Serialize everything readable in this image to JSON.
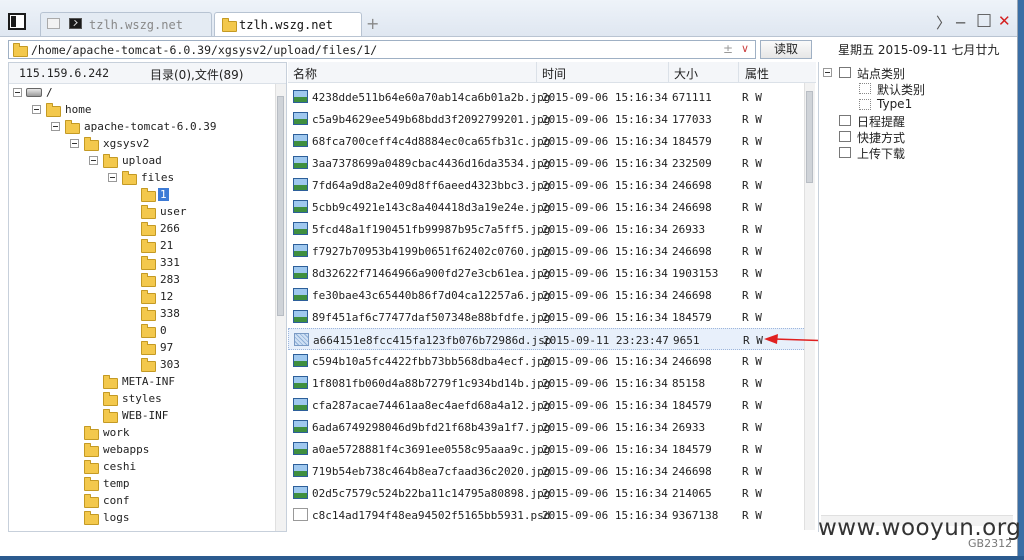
{
  "tabs": [
    {
      "label": "tzlh.wszg.net",
      "active": false,
      "icon": "terminal-icon"
    },
    {
      "label": "tzlh.wszg.net",
      "active": true,
      "icon": "folder-icon"
    }
  ],
  "window_controls": {
    "forward": "〉",
    "minimize": "─",
    "maximize": "□",
    "close": "✕"
  },
  "address": {
    "path": "/home/apache-tomcat-6.0.39/xgsysv2/upload/files/1/",
    "add_remove": "± ",
    "dropdown": "∨"
  },
  "read_button": "读取",
  "date_text": "星期五 2015-09-11 七月廿九",
  "left_pane": {
    "ip": "115.159.6.242",
    "summary": "目录(0),文件(89)",
    "tree": [
      {
        "label": "/",
        "depth": 0,
        "drive": true,
        "selected": false
      },
      {
        "label": "home",
        "depth": 1,
        "selected": false
      },
      {
        "label": "apache-tomcat-6.0.39",
        "depth": 2,
        "selected": false
      },
      {
        "label": "xgsysv2",
        "depth": 3,
        "selected": false
      },
      {
        "label": "upload",
        "depth": 4,
        "selected": false
      },
      {
        "label": "files",
        "depth": 5,
        "selected": false
      },
      {
        "label": "1",
        "depth": 6,
        "selected": true
      },
      {
        "label": "user",
        "depth": 6,
        "selected": false
      },
      {
        "label": "266",
        "depth": 6,
        "selected": false
      },
      {
        "label": "21",
        "depth": 6,
        "selected": false
      },
      {
        "label": "331",
        "depth": 6,
        "selected": false
      },
      {
        "label": "283",
        "depth": 6,
        "selected": false
      },
      {
        "label": "12",
        "depth": 6,
        "selected": false
      },
      {
        "label": "338",
        "depth": 6,
        "selected": false
      },
      {
        "label": "0",
        "depth": 6,
        "selected": false
      },
      {
        "label": "97",
        "depth": 6,
        "selected": false
      },
      {
        "label": "303",
        "depth": 6,
        "selected": false
      },
      {
        "label": "META-INF",
        "depth": 4,
        "selected": false
      },
      {
        "label": "styles",
        "depth": 4,
        "selected": false
      },
      {
        "label": "WEB-INF",
        "depth": 4,
        "selected": false
      },
      {
        "label": "work",
        "depth": 3,
        "selected": false
      },
      {
        "label": "webapps",
        "depth": 3,
        "selected": false
      },
      {
        "label": "ceshi",
        "depth": 3,
        "selected": false
      },
      {
        "label": "temp",
        "depth": 3,
        "selected": false
      },
      {
        "label": "conf",
        "depth": 3,
        "selected": false
      },
      {
        "label": "logs",
        "depth": 3,
        "selected": false
      }
    ]
  },
  "file_list": {
    "columns": {
      "name": "名称",
      "time": "时间",
      "size": "大小",
      "attr": "属性"
    },
    "rows": [
      {
        "name": "4238dde511b64e60a70ab14ca6b01a2b.jpg",
        "time": "2015-09-06 15:16:34",
        "size": "671111",
        "attr": "R W",
        "type": "img"
      },
      {
        "name": "c5a9b4629ee549b68bdd3f2092799201.jpg",
        "time": "2015-09-06 15:16:34",
        "size": "177033",
        "attr": "R W",
        "type": "img"
      },
      {
        "name": "68fca700ceff4c4d8884ec0ca65fb31c.jpg",
        "time": "2015-09-06 15:16:34",
        "size": "184579",
        "attr": "R W",
        "type": "img"
      },
      {
        "name": "3aa7378699a0489cbac4436d16da3534.jpg",
        "time": "2015-09-06 15:16:34",
        "size": "232509",
        "attr": "R W",
        "type": "img"
      },
      {
        "name": "7fd64a9d8a2e409d8ff6aeed4323bbc3.jpg",
        "time": "2015-09-06 15:16:34",
        "size": "246698",
        "attr": "R W",
        "type": "img"
      },
      {
        "name": "5cbb9c4921e143c8a404418d3a19e24e.jpg",
        "time": "2015-09-06 15:16:34",
        "size": "246698",
        "attr": "R W",
        "type": "img"
      },
      {
        "name": "5fcd48a1f190451fb99987b95c7a5ff5.jpg",
        "time": "2015-09-06 15:16:34",
        "size": "26933",
        "attr": "R W",
        "type": "img"
      },
      {
        "name": "f7927b70953b4199b0651f62402c0760.jpg",
        "time": "2015-09-06 15:16:34",
        "size": "246698",
        "attr": "R W",
        "type": "img"
      },
      {
        "name": "8d32622f71464966a900fd27e3cb61ea.jpg",
        "time": "2015-09-06 15:16:34",
        "size": "1903153",
        "attr": "R W",
        "type": "img"
      },
      {
        "name": "fe30bae43c65440b86f7d04ca12257a6.jpg",
        "time": "2015-09-06 15:16:34",
        "size": "246698",
        "attr": "R W",
        "type": "img"
      },
      {
        "name": "89f451af6c77477daf507348e88bfdfe.jpg",
        "time": "2015-09-06 15:16:34",
        "size": "184579",
        "attr": "R W",
        "type": "img"
      },
      {
        "name": "a664151e8fcc415fa123fb076b72986d.jsp",
        "time": "2015-09-11 23:23:47",
        "size": "9651",
        "attr": "R W",
        "type": "jsp",
        "selected": true
      },
      {
        "name": "c594b10a5fc4422fbb73bb568dba4ecf.jpg",
        "time": "2015-09-06 15:16:34",
        "size": "246698",
        "attr": "R W",
        "type": "img"
      },
      {
        "name": "1f8081fb060d4a88b7279f1c934bd14b.jpg",
        "time": "2015-09-06 15:16:34",
        "size": "85158",
        "attr": "R W",
        "type": "img"
      },
      {
        "name": "cfa287acae74461aa8ec4aefd68a4a12.jpg",
        "time": "2015-09-06 15:16:34",
        "size": "184579",
        "attr": "R W",
        "type": "img"
      },
      {
        "name": "6ada6749298046d9bfd21f68b439a1f7.jpg",
        "time": "2015-09-06 15:16:34",
        "size": "26933",
        "attr": "R W",
        "type": "img"
      },
      {
        "name": "a0ae5728881f4c3691ee0558c95aaa9c.jpg",
        "time": "2015-09-06 15:16:34",
        "size": "184579",
        "attr": "R W",
        "type": "img"
      },
      {
        "name": "719b54eb738c464b8ea7cfaad36c2020.jpg",
        "time": "2015-09-06 15:16:34",
        "size": "246698",
        "attr": "R W",
        "type": "img"
      },
      {
        "name": "02d5c7579c524b22ba11c14795a80898.jpg",
        "time": "2015-09-06 15:16:34",
        "size": "214065",
        "attr": "R W",
        "type": "img"
      },
      {
        "name": "c8c14ad1794f48ea94502f5165bb5931.psd",
        "time": "2015-09-06 15:16:34",
        "size": "9367138",
        "attr": "R W",
        "type": "doc"
      }
    ]
  },
  "right_pane": {
    "items": [
      {
        "label": "站点类别",
        "indent": 0,
        "expander": true,
        "icon": "category-icon"
      },
      {
        "label": "默认类别",
        "indent": 1,
        "expander": false,
        "icon": "dotted-box-icon"
      },
      {
        "label": "Type1",
        "indent": 1,
        "expander": false,
        "icon": "dotted-box-icon"
      },
      {
        "label": "日程提醒",
        "indent": 0,
        "expander": false,
        "icon": "clock-icon"
      },
      {
        "label": "快捷方式",
        "indent": 0,
        "expander": false,
        "icon": "shortcut-icon"
      },
      {
        "label": "上传下载",
        "indent": 0,
        "expander": false,
        "icon": "transfer-icon"
      }
    ]
  },
  "watermark": "www.wooyun.org",
  "encoding": "GB2312",
  "colors": {
    "selection": "#3d7bd6",
    "folder": "#f3c84c",
    "arrow": "#e02020",
    "close": "#d42020"
  }
}
